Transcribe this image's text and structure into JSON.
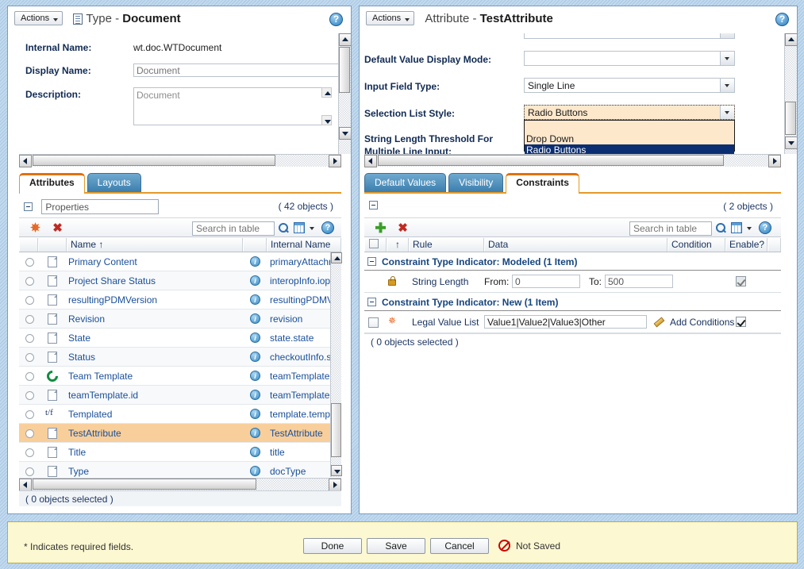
{
  "left_panel": {
    "actions_label": "Actions",
    "title_prefix": "Type - ",
    "title_name": "Document",
    "fields": [
      {
        "label": "Internal Name:",
        "value": "wt.doc.WTDocument"
      },
      {
        "label": "Display Name:",
        "value": "Document"
      },
      {
        "label": "Description:",
        "value": "Document"
      }
    ],
    "tabs": [
      {
        "label": "Attributes",
        "active": true
      },
      {
        "label": "Layouts",
        "active": false
      }
    ],
    "table": {
      "view_selector": "Properties",
      "object_count": "( 42 objects )",
      "search_placeholder": "Search in table",
      "columns": [
        "",
        "",
        "Name  ↑",
        "",
        "Internal Name"
      ],
      "rows": [
        {
          "name": "Primary Content",
          "internal": "primaryAttachmen",
          "icon": "file",
          "selected": false
        },
        {
          "name": "Project Share Status",
          "internal": "interopInfo.iopSta",
          "icon": "file",
          "selected": false
        },
        {
          "name": "resultingPDMVersion",
          "internal": "resultingPDMVers",
          "icon": "file",
          "selected": false
        },
        {
          "name": "Revision",
          "internal": "revision",
          "icon": "file",
          "selected": false
        },
        {
          "name": "State",
          "internal": "state.state",
          "icon": "file",
          "selected": false
        },
        {
          "name": "Status",
          "internal": "checkoutInfo.state",
          "icon": "file",
          "selected": false
        },
        {
          "name": "Team Template",
          "internal": "teamTemplateId",
          "icon": "team",
          "selected": false
        },
        {
          "name": "teamTemplate.id",
          "internal": "teamTemplate.id",
          "icon": "file",
          "selected": false
        },
        {
          "name": "Templated",
          "internal": "template.template",
          "icon": "tf",
          "selected": false
        },
        {
          "name": "TestAttribute",
          "internal": "TestAttribute",
          "icon": "file",
          "selected": true
        },
        {
          "name": "Title",
          "internal": "title",
          "icon": "file",
          "selected": false
        },
        {
          "name": "Type",
          "internal": "docType",
          "icon": "file",
          "selected": false
        }
      ],
      "status": "( 0 objects selected )"
    }
  },
  "right_panel": {
    "actions_label": "Actions",
    "title_prefix": "Attribute - ",
    "title_name": "TestAttribute",
    "fields": [
      {
        "label": "Default Value Display Mode:",
        "value": ""
      },
      {
        "label": "Input Field Type:",
        "value": "Single Line"
      },
      {
        "label": "Selection List Style:",
        "value": "Radio Buttons"
      },
      {
        "label": "String Length Threshold For",
        "label2": "Multiple Line Input:",
        "value": ""
      }
    ],
    "dropdown": {
      "open": true,
      "options": [
        "",
        "Drop Down",
        "Radio Buttons"
      ],
      "highlighted": "Radio Buttons"
    },
    "tabs": [
      {
        "label": "Default Values",
        "active": false
      },
      {
        "label": "Visibility",
        "active": false
      },
      {
        "label": "Constraints",
        "active": true
      }
    ],
    "table": {
      "object_count": "( 2 objects )",
      "search_placeholder": "Search in table",
      "columns": [
        "",
        "↑",
        "Rule",
        "Data",
        "Condition",
        "Enable?",
        ""
      ],
      "groups": [
        {
          "label": "Constraint Type Indicator: Modeled (1 Item)",
          "rows": [
            {
              "icon": "lock",
              "rule": "String Length",
              "from_label": "From:",
              "from_value": "0",
              "to_label": "To:",
              "to_value": "500",
              "enabled": true,
              "enabled_disabled": true
            }
          ]
        },
        {
          "label": "Constraint Type Indicator: New (1 Item)",
          "rows": [
            {
              "icon": "new",
              "rule": "Legal Value List",
              "data_value": "Value1|Value2|Value3|Other",
              "condition_label": "Add Conditions",
              "enabled": true,
              "enabled_disabled": false
            }
          ]
        }
      ],
      "status": "( 0 objects selected )"
    }
  },
  "footer": {
    "required_note": "* Indicates required fields.",
    "buttons": [
      {
        "label": "Done"
      },
      {
        "label": "Save"
      },
      {
        "label": "Cancel"
      }
    ],
    "save_status": "Not Saved"
  },
  "colors": {
    "accent_orange": "#e3700d",
    "tab_blue": "#3c7ead",
    "link_blue": "#1a4f99",
    "selected_row": "#f8cf9b",
    "footer_bg": "#fcf8d2",
    "dropdown_bg": "#fde8cc",
    "dropdown_hl": "#0b2e72",
    "not_saved_red": "#cc0000"
  }
}
